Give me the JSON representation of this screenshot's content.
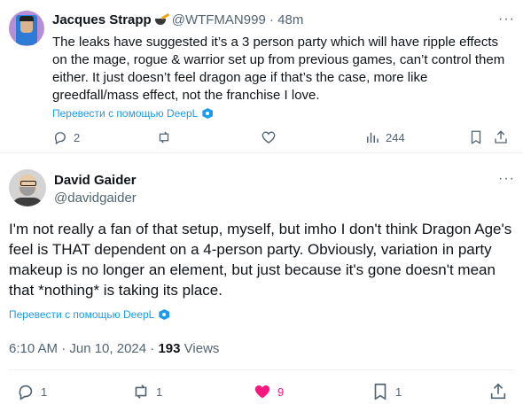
{
  "reply": {
    "author_name": "Jacques Strapp",
    "handle": "@WTFMAN999",
    "separator": "·",
    "time": "48m",
    "text": "The leaks have suggested it’s a 3 person party which will have ripple effects on the mage, rogue & warrior set up from previous games, can’t control them either. It just doesn’t feel dragon age if that’s the case, more like greedfall/mass effect, not the franchise I love.",
    "translate_label": "Перевести с помощью DeepL",
    "stats": {
      "replies": "2",
      "views": "244"
    }
  },
  "tweet": {
    "author_name": "David Gaider",
    "handle": "@davidgaider",
    "text": "I'm not really a fan of that setup, myself, but imho I don't think Dragon Age's feel is THAT dependent on a 4-person party. Obviously, variation in party makeup is no longer an element, but just because it's gone doesn't mean that *nothing* is taking its place.",
    "translate_label": "Перевести с помощью DeepL",
    "timestamp": "6:10 AM · Jun 10, 2024 ·",
    "views_count": "193",
    "views_label": "Views",
    "stats": {
      "replies": "1",
      "reposts": "1",
      "likes": "9",
      "bookmarks": "1"
    }
  },
  "colors": {
    "accent": "#1d9bf0",
    "like": "#f91880",
    "muted": "#536471",
    "text": "#0f1419"
  }
}
